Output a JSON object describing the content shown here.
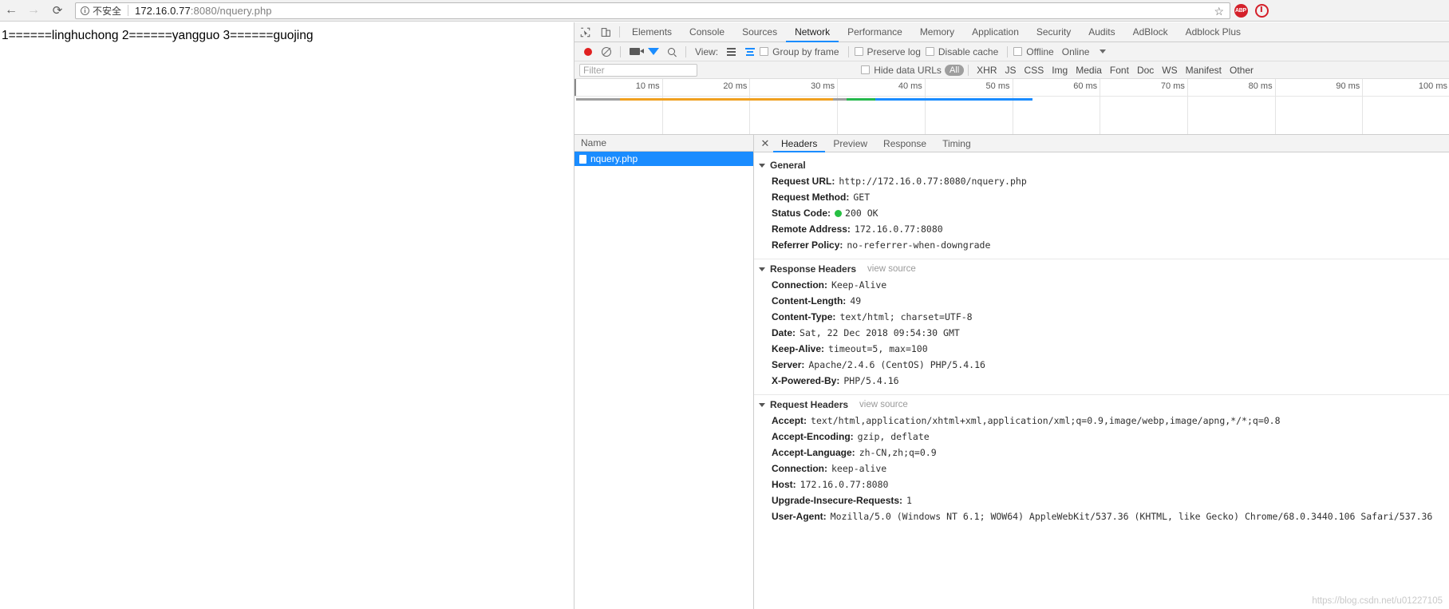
{
  "browser": {
    "back_icon": "back-arrow-icon",
    "forward_icon": "forward-arrow-icon",
    "reload_icon": "reload-icon",
    "security_label": "不安全",
    "url_host": "172.16.0.77",
    "url_rest": ":8080/nquery.php",
    "star_icon": "☆",
    "extensions": [
      {
        "name": "adblock-extension",
        "label": "ABP"
      },
      {
        "name": "adblock-plus-extension",
        "label": ""
      }
    ]
  },
  "page": {
    "body_text": "1======linghuchong 2======yangguo 3======guojing"
  },
  "devtools": {
    "tabs": [
      {
        "label": "Elements",
        "active": false
      },
      {
        "label": "Console",
        "active": false
      },
      {
        "label": "Sources",
        "active": false
      },
      {
        "label": "Network",
        "active": true
      },
      {
        "label": "Performance",
        "active": false
      },
      {
        "label": "Memory",
        "active": false
      },
      {
        "label": "Application",
        "active": false
      },
      {
        "label": "Security",
        "active": false
      },
      {
        "label": "Audits",
        "active": false
      },
      {
        "label": "AdBlock",
        "active": false
      },
      {
        "label": "Adblock Plus",
        "active": false
      }
    ],
    "toolbar": {
      "record_icon": "record-icon",
      "clear_icon": "clear-icon",
      "screenshot_icon": "camera-icon",
      "filter_icon": "funnel-icon",
      "search_icon": "search-icon",
      "view_label": "View:",
      "list_view_icon": "list-view-icon",
      "waterfall_view_icon": "waterfall-view-icon",
      "group_by_frame": "Group by frame",
      "preserve_log": "Preserve log",
      "disable_cache": "Disable cache",
      "offline": "Offline",
      "throttle_value": "Online",
      "throttle_caret": "chevron-down-icon"
    },
    "filterbar": {
      "filter_placeholder": "Filter",
      "hide_data_urls": "Hide data URLs",
      "types": [
        "All",
        "XHR",
        "JS",
        "CSS",
        "Img",
        "Media",
        "Font",
        "Doc",
        "WS",
        "Manifest",
        "Other"
      ],
      "active_type": "All"
    },
    "overview": {
      "ticks": [
        "10 ms",
        "20 ms",
        "30 ms",
        "40 ms",
        "50 ms",
        "60 ms",
        "70 ms",
        "80 ms",
        "90 ms",
        "100 ms"
      ],
      "segments": [
        {
          "name": "stalled",
          "color": "#9e9e9e",
          "start_pct": 0.0,
          "width_pct": 5.0
        },
        {
          "name": "request-sent",
          "color": "#f0a020",
          "start_pct": 5.0,
          "width_pct": 24.5
        },
        {
          "name": "waiting",
          "color": "#9e9e9e",
          "start_pct": 29.5,
          "width_pct": 1.5
        },
        {
          "name": "content-download",
          "color": "#25b84c",
          "start_pct": 31.0,
          "width_pct": 3.3
        },
        {
          "name": "finish",
          "color": "#1a8cff",
          "start_pct": 34.3,
          "width_pct": 18.0
        }
      ]
    },
    "requests": {
      "column_header": "Name",
      "rows": [
        {
          "name": "nquery.php",
          "selected": true,
          "icon": "document-icon"
        }
      ]
    },
    "detail": {
      "close_icon": "✕",
      "tabs": [
        {
          "label": "Headers",
          "active": true
        },
        {
          "label": "Preview",
          "active": false
        },
        {
          "label": "Response",
          "active": false
        },
        {
          "label": "Timing",
          "active": false
        }
      ],
      "sections": [
        {
          "title": "General",
          "view_source": "",
          "rows": [
            {
              "name": "Request URL:",
              "value": "http://172.16.0.77:8080/nquery.php"
            },
            {
              "name": "Request Method:",
              "value": "GET"
            },
            {
              "name": "Status Code:",
              "value": "200 OK",
              "status_dot": true
            },
            {
              "name": "Remote Address:",
              "value": "172.16.0.77:8080"
            },
            {
              "name": "Referrer Policy:",
              "value": "no-referrer-when-downgrade"
            }
          ]
        },
        {
          "title": "Response Headers",
          "view_source": "view source",
          "rows": [
            {
              "name": "Connection:",
              "value": "Keep-Alive"
            },
            {
              "name": "Content-Length:",
              "value": "49"
            },
            {
              "name": "Content-Type:",
              "value": "text/html; charset=UTF-8"
            },
            {
              "name": "Date:",
              "value": "Sat, 22 Dec 2018 09:54:30 GMT"
            },
            {
              "name": "Keep-Alive:",
              "value": "timeout=5, max=100"
            },
            {
              "name": "Server:",
              "value": "Apache/2.4.6 (CentOS) PHP/5.4.16"
            },
            {
              "name": "X-Powered-By:",
              "value": "PHP/5.4.16"
            }
          ]
        },
        {
          "title": "Request Headers",
          "view_source": "view source",
          "rows": [
            {
              "name": "Accept:",
              "value": "text/html,application/xhtml+xml,application/xml;q=0.9,image/webp,image/apng,*/*;q=0.8"
            },
            {
              "name": "Accept-Encoding:",
              "value": "gzip, deflate"
            },
            {
              "name": "Accept-Language:",
              "value": "zh-CN,zh;q=0.9"
            },
            {
              "name": "Connection:",
              "value": "keep-alive"
            },
            {
              "name": "Host:",
              "value": "172.16.0.77:8080"
            },
            {
              "name": "Upgrade-Insecure-Requests:",
              "value": "1"
            },
            {
              "name": "User-Agent:",
              "value": "Mozilla/5.0 (Windows NT 6.1; WOW64) AppleWebKit/537.36 (KHTML, like Gecko) Chrome/68.0.3440.106 Safari/537.36",
              "wrap": true
            }
          ]
        }
      ]
    }
  },
  "watermark": "https://blog.csdn.net/u01227105"
}
